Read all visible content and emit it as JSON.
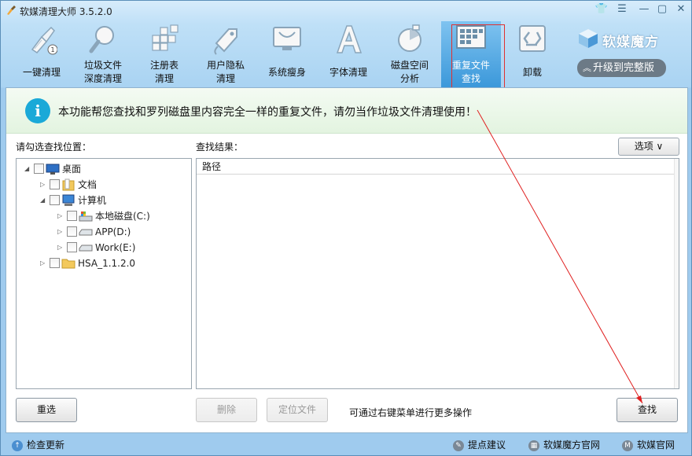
{
  "window": {
    "title": "软媒清理大师 3.5.2.0"
  },
  "toolbar": {
    "items": [
      {
        "label1": "一键清理",
        "label2": ""
      },
      {
        "label1": "垃圾文件",
        "label2": "深度清理"
      },
      {
        "label1": "注册表",
        "label2": "清理"
      },
      {
        "label1": "用户隐私",
        "label2": "清理"
      },
      {
        "label1": "系统瘦身",
        "label2": ""
      },
      {
        "label1": "字体清理",
        "label2": ""
      },
      {
        "label1": "磁盘空间",
        "label2": "分析"
      },
      {
        "label1": "重复文件",
        "label2": "查找"
      },
      {
        "label1": "卸载",
        "label2": ""
      }
    ],
    "badge": "1"
  },
  "brand": {
    "name": "软媒魔方",
    "upgrade": "升级到完整版"
  },
  "banner": {
    "text": "本功能帮您查找和罗列磁盘里内容完全一样的重复文件，请勿当作垃圾文件清理使用！",
    "icon": "i"
  },
  "left_panel": {
    "label": "请勾选查找位置：",
    "tree": [
      {
        "label": "桌面"
      },
      {
        "label": "文档"
      },
      {
        "label": "计算机"
      },
      {
        "label": "本地磁盘(C:)"
      },
      {
        "label": "APP(D:)"
      },
      {
        "label": "Work(E:)"
      },
      {
        "label": "HSA_1.1.2.0"
      }
    ]
  },
  "results": {
    "label": "查找结果：",
    "column": "路径"
  },
  "options_button": "选项 ∨",
  "buttons": {
    "reset": "重选",
    "delete": "删除",
    "locate": "定位文件",
    "search": "查找"
  },
  "hint": "可通过右键菜单进行更多操作",
  "statusbar": {
    "update": "检查更新",
    "feedback": "提点建议",
    "site_mofang": "软媒魔方官网",
    "site": "软媒官网"
  }
}
